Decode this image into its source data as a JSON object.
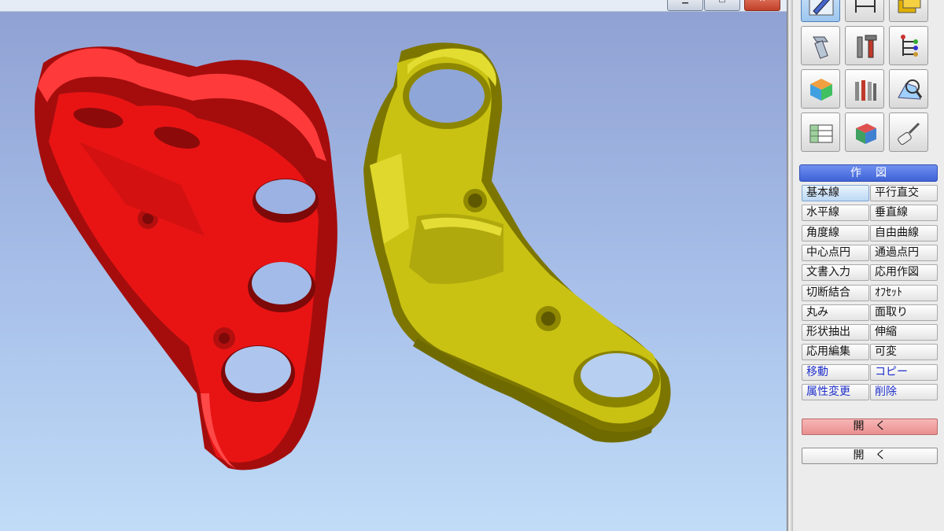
{
  "window": {
    "minimize_glyph": "▁",
    "maximize_glyph": "▢",
    "close_glyph": "✕"
  },
  "viewport": {
    "background_top": "#8fa0d2",
    "background_bottom": "#c0dcf7",
    "parts": [
      {
        "name": "red-bracket-part",
        "color": "#ee1a1a"
      },
      {
        "name": "yellow-bracket-part",
        "color": "#c8c010"
      }
    ]
  },
  "toolbar": {
    "icons": [
      {
        "name": "edit-icon",
        "selected": true
      },
      {
        "name": "dimension-icon",
        "selected": false
      },
      {
        "name": "layers-icon",
        "selected": false
      },
      {
        "name": "bolt-icon",
        "selected": false
      },
      {
        "name": "tools-icon",
        "selected": false
      },
      {
        "name": "tree-icon",
        "selected": false
      },
      {
        "name": "color-cube-icon",
        "selected": false
      },
      {
        "name": "multi-tools-icon",
        "selected": false
      },
      {
        "name": "search-3d-icon",
        "selected": false
      },
      {
        "name": "table-icon",
        "selected": false
      },
      {
        "name": "solid-block-icon",
        "selected": false
      },
      {
        "name": "paint-roller-icon",
        "selected": false
      }
    ]
  },
  "panel": {
    "section_title": "作図",
    "commands": [
      {
        "label": "基本線",
        "active": true,
        "blue": false
      },
      {
        "label": "平行直交",
        "active": false,
        "blue": false
      },
      {
        "label": "水平線",
        "active": false,
        "blue": false
      },
      {
        "label": "垂直線",
        "active": false,
        "blue": false
      },
      {
        "label": "角度線",
        "active": false,
        "blue": false
      },
      {
        "label": "自由曲線",
        "active": false,
        "blue": false
      },
      {
        "label": "中心点円",
        "active": false,
        "blue": false
      },
      {
        "label": "通過点円",
        "active": false,
        "blue": false
      },
      {
        "label": "文書入力",
        "active": false,
        "blue": false
      },
      {
        "label": "応用作図",
        "active": false,
        "blue": false
      },
      {
        "label": "切断結合",
        "active": false,
        "blue": false
      },
      {
        "label": "ｵﾌｾｯﾄ",
        "active": false,
        "blue": false
      },
      {
        "label": "丸み",
        "active": false,
        "blue": false
      },
      {
        "label": "面取り",
        "active": false,
        "blue": false
      },
      {
        "label": "形状抽出",
        "active": false,
        "blue": false
      },
      {
        "label": "伸縮",
        "active": false,
        "blue": false
      },
      {
        "label": "応用編集",
        "active": false,
        "blue": false
      },
      {
        "label": "可変",
        "active": false,
        "blue": false
      },
      {
        "label": "移動",
        "active": false,
        "blue": true
      },
      {
        "label": "コピー",
        "active": false,
        "blue": true
      },
      {
        "label": "属性変更",
        "active": false,
        "blue": true
      },
      {
        "label": "削除",
        "active": false,
        "blue": true
      }
    ],
    "open_red_label": "開く",
    "open_label": "開く"
  }
}
